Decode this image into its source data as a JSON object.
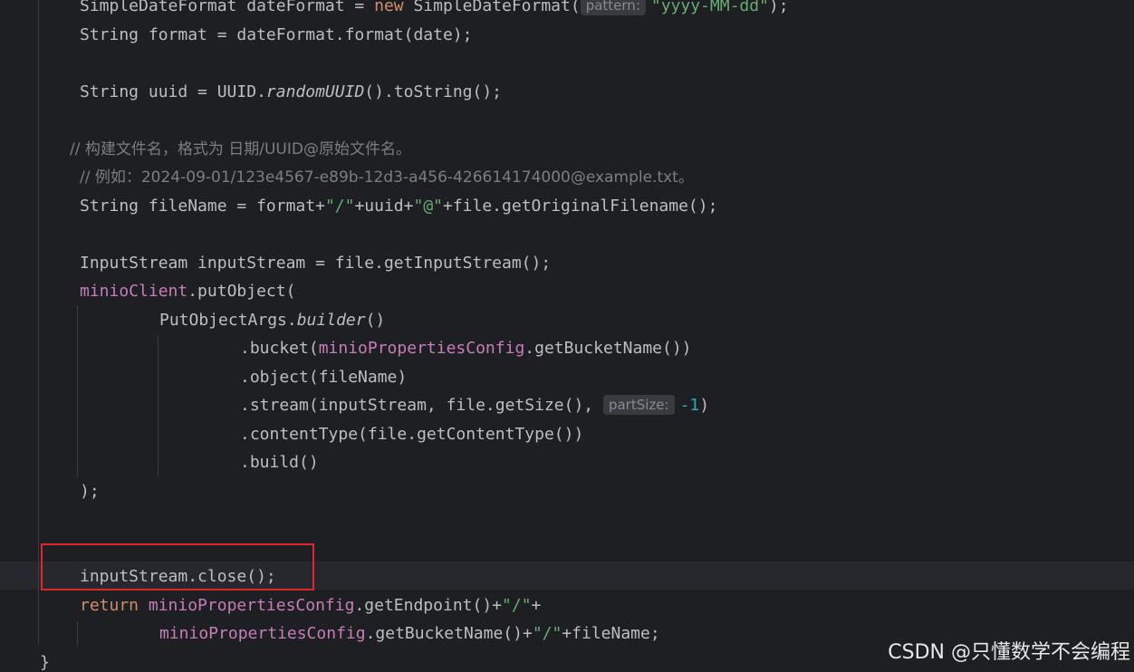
{
  "code": {
    "l1_type": "SimpleDateFormat",
    "l1_var": " dateFormat = ",
    "l1_new": "new",
    "l1_ctor": " SimpleDateFormat(",
    "l1_hint": "pattern:",
    "l1_str": "\"yyyy-MM-dd\"",
    "l1_end": ");",
    "l2": "String format = dateFormat.format(date);",
    "l3_a": "String uuid = UUID.",
    "l3_b": "randomUUID",
    "l3_c": "().toString();",
    "l4_comment": "// 构建文件名，格式为 日期/UUID@原始文件名。",
    "l5_comment": "// 例如：2024-09-01/123e4567-e89b-12d3-a456-426614174000@example.txt。",
    "l6_a": "String fileName = format+",
    "l6_s1": "\"/\"",
    "l6_b": "+uuid+",
    "l6_s2": "\"@\"",
    "l6_c": "+file.getOriginalFilename();",
    "l7": "InputStream inputStream = file.getInputStream();",
    "l8_field": "minioClient",
    "l8_rest": ".putObject(",
    "l9_a": "PutObjectArgs.",
    "l9_b": "builder",
    "l9_c": "()",
    "l10_a": ".bucket(",
    "l10_field": "minioPropertiesConfig",
    "l10_c": ".getBucketName())",
    "l11": ".object(fileName)",
    "l12_a": ".stream(inputStream, file.getSize(), ",
    "l12_hint": "partSize:",
    "l12_num": "-1",
    "l12_end": ")",
    "l13": ".contentType(file.getContentType())",
    "l14": ".build()",
    "l15": ");",
    "l16": "inputStream.close();",
    "l17_kw": "return",
    "l17_field": " minioPropertiesConfig",
    "l17_b": ".getEndpoint()+",
    "l17_s": "\"/\"",
    "l17_c": "+",
    "l18_field": "minioPropertiesConfig",
    "l18_b": ".getBucketName()+",
    "l18_s": "\"/\"",
    "l18_c": "+fileName;",
    "l19": "}"
  },
  "watermark": "CSDN @只懂数学不会编程",
  "colors": {
    "background": "#1e1f22",
    "keyword": "#cf8e6d",
    "string": "#6aab73",
    "field": "#c77dbb",
    "comment": "#7a7e85",
    "number": "#2aacb8",
    "highlight_box": "#e0262a"
  }
}
